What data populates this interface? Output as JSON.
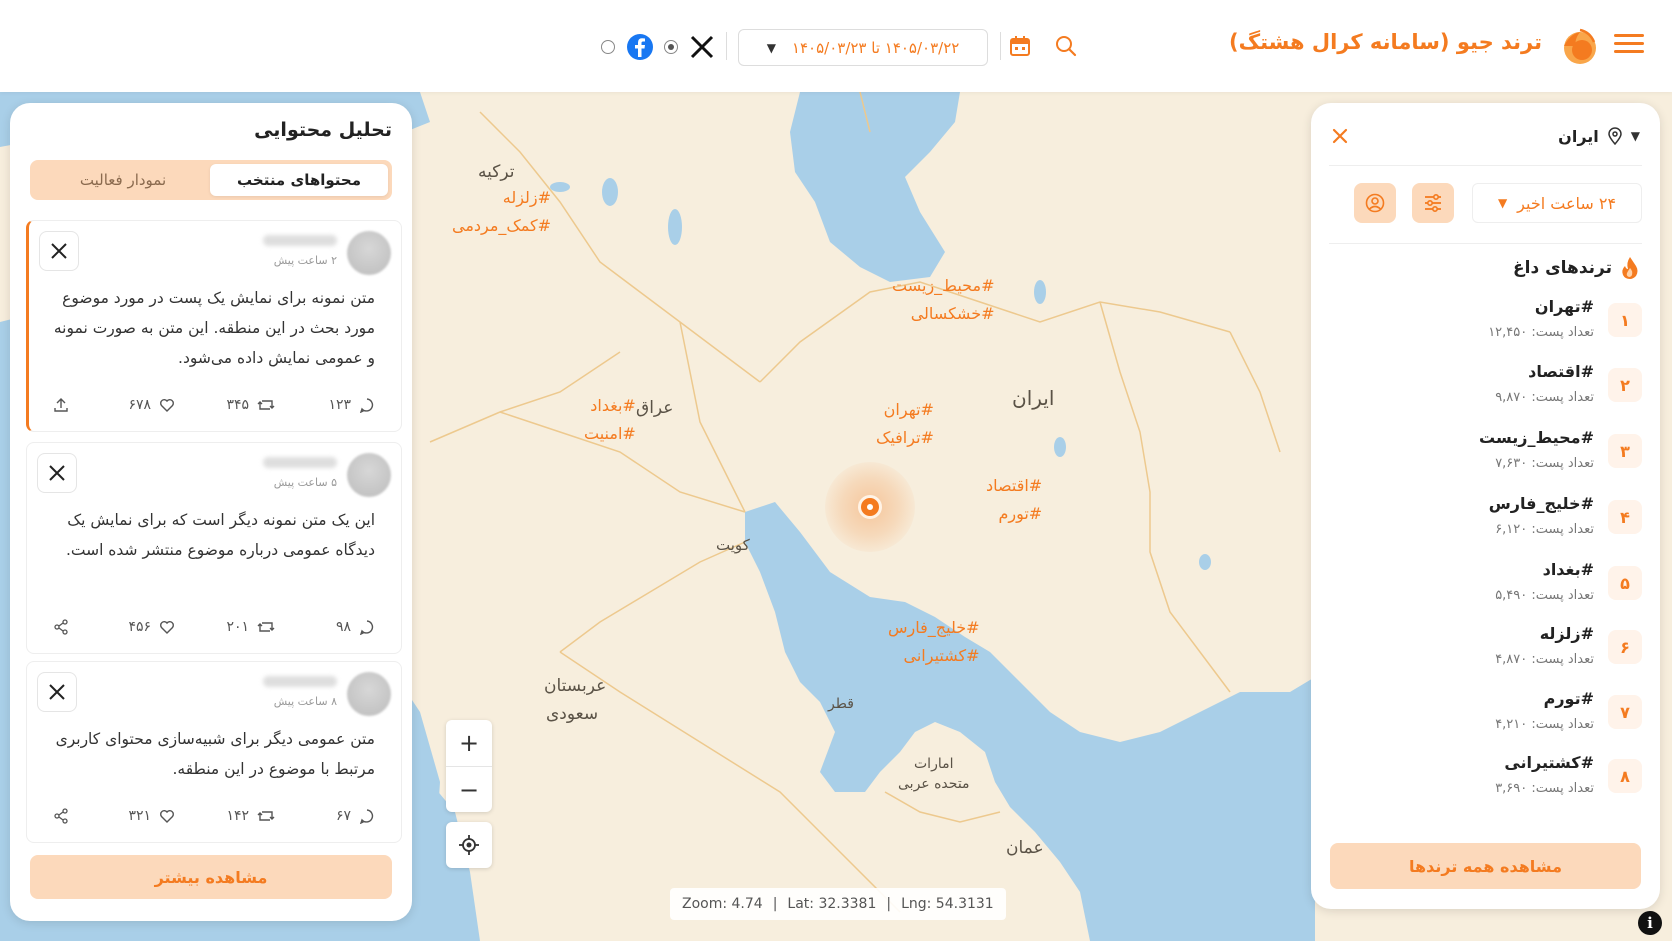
{
  "header": {
    "title": "ترند جیو (سامانه کرال هشتگ)",
    "date_range": "۱۴۰۵/۰۳/۲۲  تا  ۱۴۰۵/۰۳/۲۳",
    "icons": [
      "hamburger-icon",
      "logo-icon",
      "search-icon",
      "calendar-icon",
      "chevron-down-icon",
      "x-icon",
      "facebook-icon"
    ],
    "accent_color": "#f47b20"
  },
  "map": {
    "countries": {
      "turkey": "ترکیه",
      "iraq": "عراق",
      "iran": "ایران",
      "kuwait": "کویت",
      "saudi_line1": "عربستان",
      "saudi_line2": "سعودی",
      "qatar": "قطر",
      "uae_line1": "امارات",
      "uae_line2": "متحده عربی",
      "oman": "عمان"
    },
    "tags": {
      "turkey_1": "#زلزله",
      "turkey_2": "#کمک_مردمی",
      "env_1": "#محیط_زیست",
      "env_2": "#خشکسالی",
      "tehran_1": "#تهران",
      "tehran_2": "#ترافیک",
      "baghdad_1": "#بغداد",
      "baghdad_2": "#امنیت",
      "econ_1": "#اقتصاد",
      "econ_2": "#تورم",
      "gulf_1": "#خلیج_فارس",
      "gulf_2": "#کشتیرانی"
    },
    "zoom_in": "+",
    "zoom_out": "−",
    "coords": {
      "zoom": "Zoom: 4.74",
      "lat": "Lat: 32.3381",
      "lng": "Lng: 54.3131",
      "sep": "|"
    },
    "info": "i",
    "colors": {
      "land": "#f7eedd",
      "water": "#a9cfe8",
      "border": "#edc98e"
    }
  },
  "left_panel": {
    "title": "تحلیل محتوایی",
    "tabs": [
      {
        "label": "محتواهای منتخب",
        "active": true
      },
      {
        "label": "نمودار فعالیت",
        "active": false
      }
    ],
    "posts": [
      {
        "time": "۲ ساعت پیش",
        "text": "متن نمونه برای نمایش یک پست در مورد موضوع مورد بحث در این منطقه. این متن به صورت نمونه و عمومی نمایش داده می‌شود.",
        "replies": "۱۲۳",
        "retweets": "۳۴۵",
        "likes": "۶۷۸",
        "last_action": "upload-icon"
      },
      {
        "time": "۵ ساعت پیش",
        "text": "این یک متن نمونه دیگر است که برای نمایش یک دیدگاه عمومی درباره موضوع منتشر شده است.",
        "replies": "۹۸",
        "retweets": "۲۰۱",
        "likes": "۴۵۶",
        "last_action": "share-icon"
      },
      {
        "time": "۸ ساعت پیش",
        "text": "متن عمومی دیگر برای شبیه‌سازی محتوای کاربری مرتبط با موضوع در این منطقه.",
        "replies": "۶۷",
        "retweets": "۱۴۲",
        "likes": "۳۲۱",
        "last_action": "share-icon"
      }
    ],
    "more_label": "مشاهده بیشتر"
  },
  "right_panel": {
    "location": "ایران",
    "time_range": "۲۴ ساعت اخیر",
    "hot_title": "ترندهای داغ",
    "count_prefix": "تعداد پست:",
    "trends": [
      {
        "rank": "۱",
        "name": "#تهران",
        "count": "۱۲,۴۵۰"
      },
      {
        "rank": "۲",
        "name": "#اقتصاد",
        "count": "۹,۸۷۰"
      },
      {
        "rank": "۳",
        "name": "#محیط_زیست",
        "count": "۷,۶۳۰"
      },
      {
        "rank": "۴",
        "name": "#خلیج_فارس",
        "count": "۶,۱۲۰"
      },
      {
        "rank": "۵",
        "name": "#بغداد",
        "count": "۵,۴۹۰"
      },
      {
        "rank": "۶",
        "name": "#زلزله",
        "count": "۴,۸۷۰"
      },
      {
        "rank": "۷",
        "name": "#تورم",
        "count": "۴,۲۱۰"
      },
      {
        "rank": "۸",
        "name": "#کشتیرانی",
        "count": "۳,۶۹۰"
      }
    ],
    "all_trends_label": "مشاهده همه ترندها"
  }
}
